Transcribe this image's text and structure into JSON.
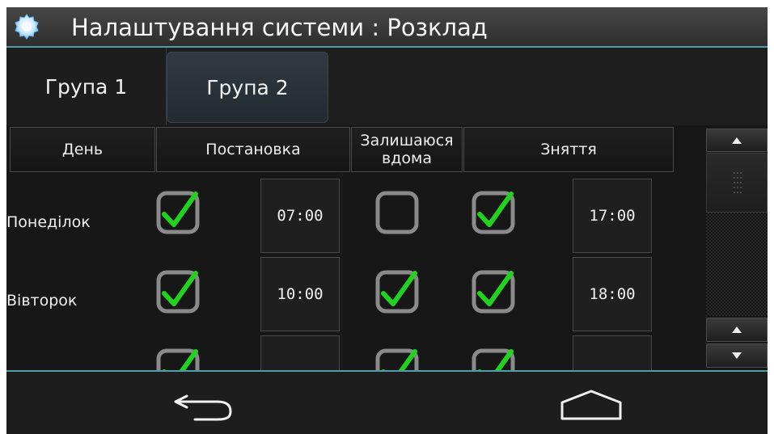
{
  "title": "Налаштування системи : Розклад",
  "tabs": [
    {
      "label": "Група 1"
    },
    {
      "label": "Група 2"
    }
  ],
  "table": {
    "headers": {
      "day": "День",
      "arm": "Постановка",
      "stay_home": "Залишаюся\nвдома",
      "disarm": "Зняття"
    },
    "rows": [
      {
        "day": "Понеділок",
        "arm_checked": true,
        "arm_time": "07:00",
        "stay_checked": false,
        "disarm_checked": true,
        "disarm_time": "17:00"
      },
      {
        "day": "Вівторок",
        "arm_checked": true,
        "arm_time": "10:00",
        "stay_checked": true,
        "disarm_checked": true,
        "disarm_time": "18:00"
      },
      {
        "day": "",
        "arm_checked": true,
        "arm_time": "",
        "stay_checked": true,
        "disarm_checked": true,
        "disarm_time": ""
      }
    ]
  },
  "scrollbar": {
    "up_icon": "triangle-up-icon",
    "down_icon": "triangle-down-icon"
  },
  "navigation": {
    "back_icon": "back-arrow-icon",
    "home_icon": "home-icon"
  },
  "colors": {
    "accent": "#4e9ea8",
    "check": "#21d31f",
    "checkbox_border": "#8a8a8a"
  }
}
